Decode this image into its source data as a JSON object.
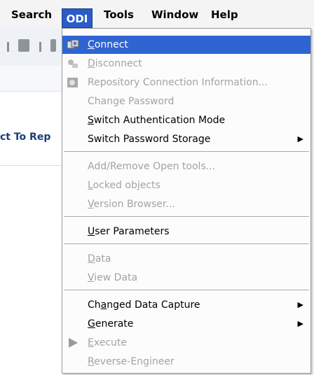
{
  "menubar": {
    "search": "Search",
    "odi": "ODI",
    "tools": "Tools",
    "window": "Window",
    "help": "Help"
  },
  "background_panel": {
    "connect_label": "ct To Rep"
  },
  "menu": {
    "connect": "Connect",
    "disconnect": "Disconnect",
    "repo_info": "Repository Connection Information...",
    "change_password": "Change Password",
    "switch_auth": "Switch Authentication Mode",
    "switch_pwd_storage": "Switch Password Storage",
    "add_remove_open_tools": "Add/Remove Open tools...",
    "locked_objects": "Locked objects",
    "version_browser": "Version Browser...",
    "user_parameters": "User Parameters",
    "data": "Data",
    "view_data": "View Data",
    "changed_data_capture": "Changed Data Capture",
    "generate": "Generate",
    "execute": "Execute",
    "reverse_engineer": "Reverse-Engineer"
  },
  "colors": {
    "highlight": "#2f64d2",
    "disabled_text": "#a3a3a3"
  }
}
